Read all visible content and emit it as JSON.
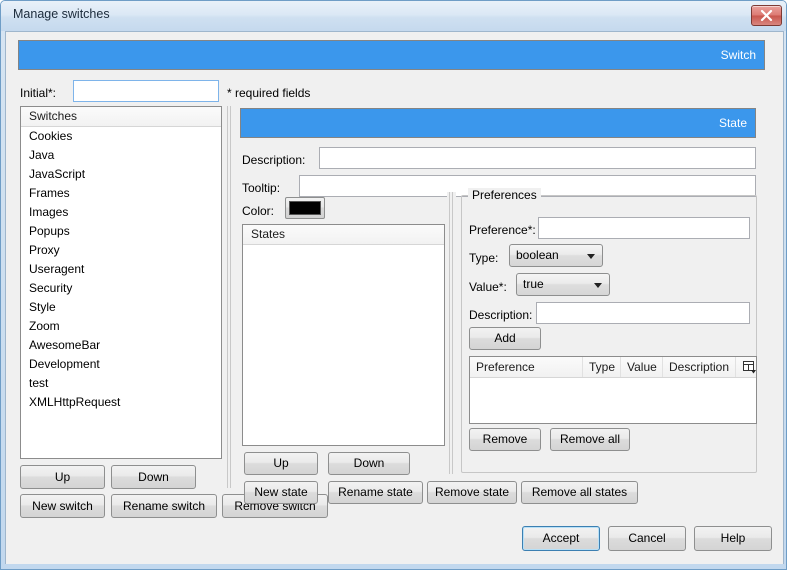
{
  "window": {
    "title": "Manage switches",
    "close_icon": "close-icon"
  },
  "switch_banner": {
    "label": "Switch",
    "color": "#3b97ec"
  },
  "initial": {
    "label": "Initial*:",
    "value": "",
    "placeholder": "",
    "required_note": "* required fields"
  },
  "switches_list": {
    "header": "Switches",
    "items": [
      "Cookies",
      "Java",
      "JavaScript",
      "Frames",
      "Images",
      "Popups",
      "Proxy",
      "Useragent",
      "Security",
      "Style",
      "Zoom",
      "AwesomeBar",
      "Development",
      "test",
      "XMLHttpRequest"
    ]
  },
  "switch_buttons": {
    "up": "Up",
    "down": "Down",
    "new_switch": "New switch",
    "rename_switch": "Rename switch",
    "remove_switch": "Remove switch"
  },
  "state_banner": {
    "label": "State",
    "color": "#3b97ec"
  },
  "state_fields": {
    "description_label": "Description:",
    "description_value": "",
    "tooltip_label": "Tooltip:",
    "tooltip_value": "",
    "color_label": "Color:",
    "color_value": "#000000"
  },
  "states_list": {
    "header": "States",
    "items": []
  },
  "state_buttons": {
    "up": "Up",
    "down": "Down",
    "new_state": "New state",
    "rename_state": "Rename state",
    "remove_state": "Remove state",
    "remove_all_states": "Remove all states"
  },
  "preferences": {
    "group_title": "Preferences",
    "preference_label": "Preference*:",
    "preference_value": "",
    "type_label": "Type:",
    "type_value": "boolean",
    "value_label": "Value*:",
    "value_value": "true",
    "description_label": "Description:",
    "description_value": "",
    "add_button": "Add",
    "table": {
      "columns": [
        "Preference",
        "Type",
        "Value",
        "Description"
      ],
      "chooser_icon": "column-chooser-icon",
      "rows": []
    },
    "remove_button": "Remove",
    "remove_all_button": "Remove all"
  },
  "dialog_buttons": {
    "accept": "Accept",
    "cancel": "Cancel",
    "help": "Help"
  }
}
